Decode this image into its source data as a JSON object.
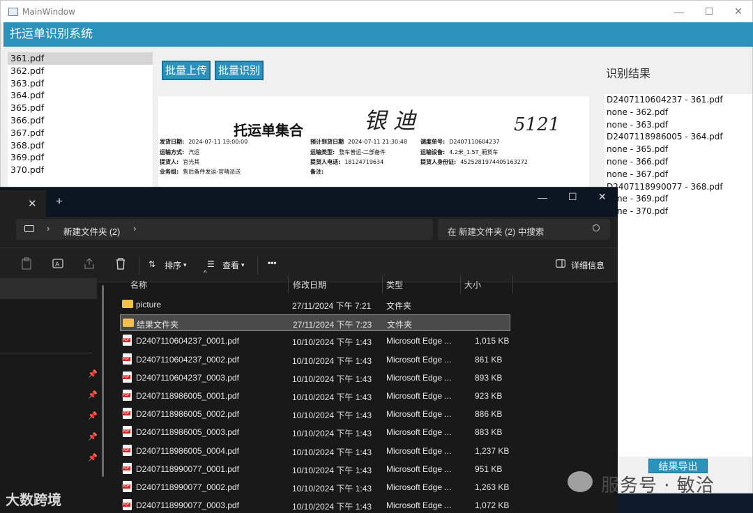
{
  "mainwindow": {
    "title": "MainWindow",
    "header": "托运单识别系统",
    "files": [
      "361.pdf",
      "362.pdf",
      "363.pdf",
      "364.pdf",
      "365.pdf",
      "366.pdf",
      "367.pdf",
      "368.pdf",
      "369.pdf",
      "370.pdf"
    ],
    "buttons": {
      "upload": "批量上传",
      "recognize": "批量识别",
      "export": "结果导出"
    },
    "results_label": "识别结果",
    "results": [
      "D2407110604237 - 361.pdf",
      "none - 362.pdf",
      "none - 363.pdf",
      "D2407118986005 - 364.pdf",
      "none - 365.pdf",
      "none - 366.pdf",
      "none - 367.pdf",
      "D2407118990077 - 368.pdf",
      "none - 369.pdf",
      "none - 370.pdf"
    ],
    "preview": {
      "doc_title": "托运单集合",
      "signature": "银 迪",
      "number": "5121",
      "fields": [
        {
          "k": "发货日期:",
          "v": "2024-07-11 19:00:00"
        },
        {
          "k": "运输方式:",
          "v": "汽运"
        },
        {
          "k": "提货人:",
          "v": "官光其"
        },
        {
          "k": "业务组:",
          "v": "售后备件发运-官晴派送"
        },
        {
          "k": "预计到货日期",
          "v": "2024-07-11 21:30:48"
        },
        {
          "k": "运输类型:",
          "v": "整车普运-二部备件"
        },
        {
          "k": "提货人电话:",
          "v": "18124719634"
        },
        {
          "k": "备注:",
          "v": ""
        },
        {
          "k": "调度单号:",
          "v": "D2407110604237"
        },
        {
          "k": "运输设备:",
          "v": "4.2米_1.5T_厢货车"
        },
        {
          "k": "提货人身份证:",
          "v": "452528197440516327​2"
        }
      ]
    }
  },
  "explorer": {
    "tab_close": "✕",
    "tab_new": "+",
    "path": "新建文件夹 (2)",
    "search_placeholder": "在 新建文件夹 (2) 中搜索",
    "toolbar": {
      "sort": "排序",
      "view": "查看",
      "more": "•••",
      "details": "详细信息"
    },
    "columns": {
      "name": "名称",
      "date": "修改日期",
      "type": "类型",
      "size": "大小"
    },
    "rows": [
      {
        "name": "picture",
        "date": "27/11/2024 下午 7:21",
        "type": "文件夹",
        "size": "",
        "kind": "folder"
      },
      {
        "name": "结果文件夹",
        "date": "27/11/2024 下午 7:23",
        "type": "文件夹",
        "size": "",
        "kind": "folder"
      },
      {
        "name": "D2407110604237_0001.pdf",
        "date": "10/10/2024 下午 1:43",
        "type": "Microsoft Edge ...",
        "size": "1,015 KB",
        "kind": "pdf"
      },
      {
        "name": "D2407110604237_0002.pdf",
        "date": "10/10/2024 下午 1:43",
        "type": "Microsoft Edge ...",
        "size": "861 KB",
        "kind": "pdf"
      },
      {
        "name": "D2407110604237_0003.pdf",
        "date": "10/10/2024 下午 1:43",
        "type": "Microsoft Edge ...",
        "size": "893 KB",
        "kind": "pdf"
      },
      {
        "name": "D2407118986005_0001.pdf",
        "date": "10/10/2024 下午 1:43",
        "type": "Microsoft Edge ...",
        "size": "923 KB",
        "kind": "pdf"
      },
      {
        "name": "D2407118986005_0002.pdf",
        "date": "10/10/2024 下午 1:43",
        "type": "Microsoft Edge ...",
        "size": "886 KB",
        "kind": "pdf"
      },
      {
        "name": "D2407118986005_0003.pdf",
        "date": "10/10/2024 下午 1:43",
        "type": "Microsoft Edge ...",
        "size": "883 KB",
        "kind": "pdf"
      },
      {
        "name": "D2407118986005_0004.pdf",
        "date": "10/10/2024 下午 1:43",
        "type": "Microsoft Edge ...",
        "size": "1,237 KB",
        "kind": "pdf"
      },
      {
        "name": "D2407118990077_0001.pdf",
        "date": "10/10/2024 下午 1:43",
        "type": "Microsoft Edge ...",
        "size": "951 KB",
        "kind": "pdf"
      },
      {
        "name": "D2407118990077_0002.pdf",
        "date": "10/10/2024 下午 1:43",
        "type": "Microsoft Edge ...",
        "size": "1,263 KB",
        "kind": "pdf"
      },
      {
        "name": "D2407118990077_0003.pdf",
        "date": "10/10/2024 下午 1:43",
        "type": "Microsoft Edge ...",
        "size": "1,072 KB",
        "kind": "pdf"
      }
    ],
    "selected_row": 1
  },
  "watermarks": {
    "brand": "大数跨境",
    "service": "服务号 · 敏洽"
  },
  "colors": {
    "accent": "#2b92bc",
    "explorer_bg": "#191919"
  }
}
